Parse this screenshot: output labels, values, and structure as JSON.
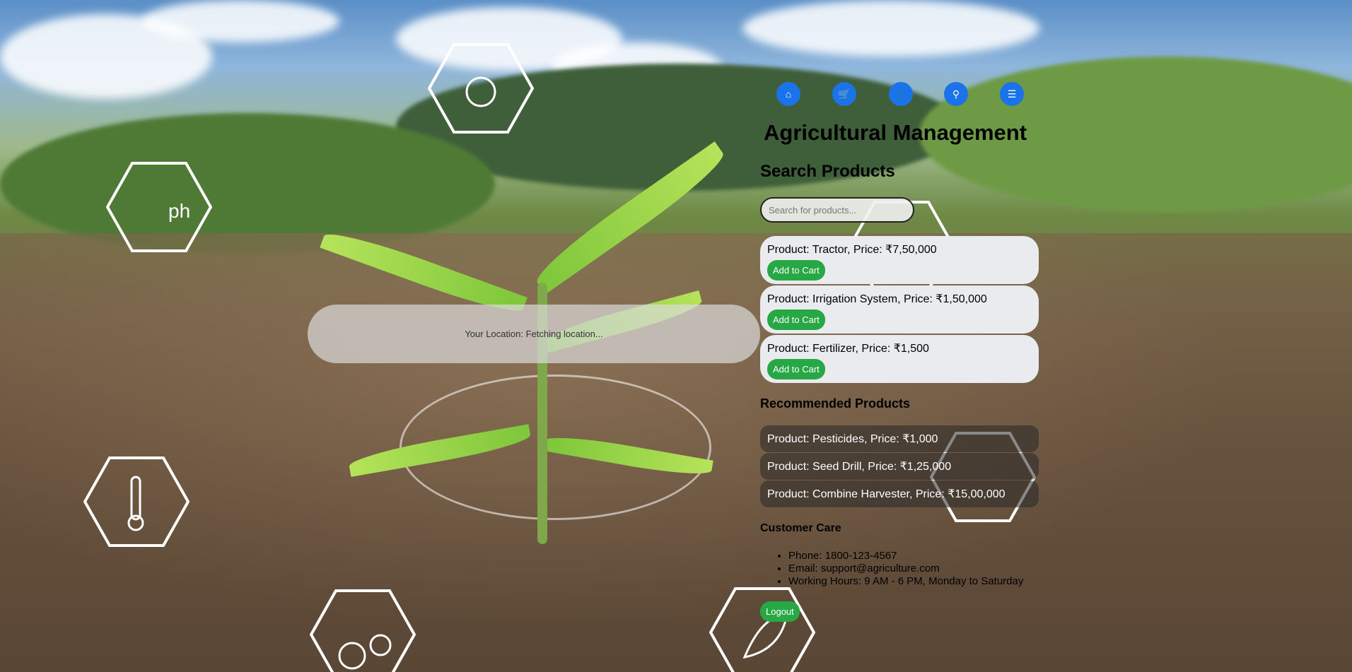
{
  "app": {
    "title": "Agricultural Management"
  },
  "nav": {
    "items": [
      {
        "name": "home",
        "icon": "home-icon"
      },
      {
        "name": "cart",
        "icon": "cart-icon"
      },
      {
        "name": "profile",
        "icon": "user-icon"
      },
      {
        "name": "search",
        "icon": "search-icon"
      },
      {
        "name": "menu",
        "icon": "menu-icon"
      }
    ]
  },
  "search": {
    "heading": "Search Products",
    "placeholder": "Search for products..."
  },
  "products": [
    {
      "label": "Product: Tractor, Price: ₹7,50,000",
      "button": "Add to Cart"
    },
    {
      "label": "Product: Irrigation System, Price: ₹1,50,000",
      "button": "Add to Cart"
    },
    {
      "label": "Product: Fertilizer, Price: ₹1,500",
      "button": "Add to Cart"
    }
  ],
  "recommended": {
    "heading": "Recommended Products",
    "items": [
      "Product: Pesticides, Price: ₹1,000",
      "Product: Seed Drill, Price: ₹1,25,000",
      "Product: Combine Harvester, Price: ₹15,00,000"
    ]
  },
  "customer_care": {
    "heading": "Customer Care",
    "items": [
      "Phone: 1800-123-4567",
      "Email: support@agriculture.com",
      "Working Hours: 9 AM - 6 PM, Monday to Saturday"
    ]
  },
  "location": {
    "text": "Your Location: Fetching location..."
  },
  "logout": {
    "label": "Logout"
  },
  "colors": {
    "nav": "#1a73e8",
    "button": "#28a745",
    "card": "#e9ebee"
  },
  "background_icons": [
    "sun-icon",
    "ph-icon",
    "thermometer-icon",
    "npk-icon",
    "leaf-icon",
    "water-icon"
  ]
}
